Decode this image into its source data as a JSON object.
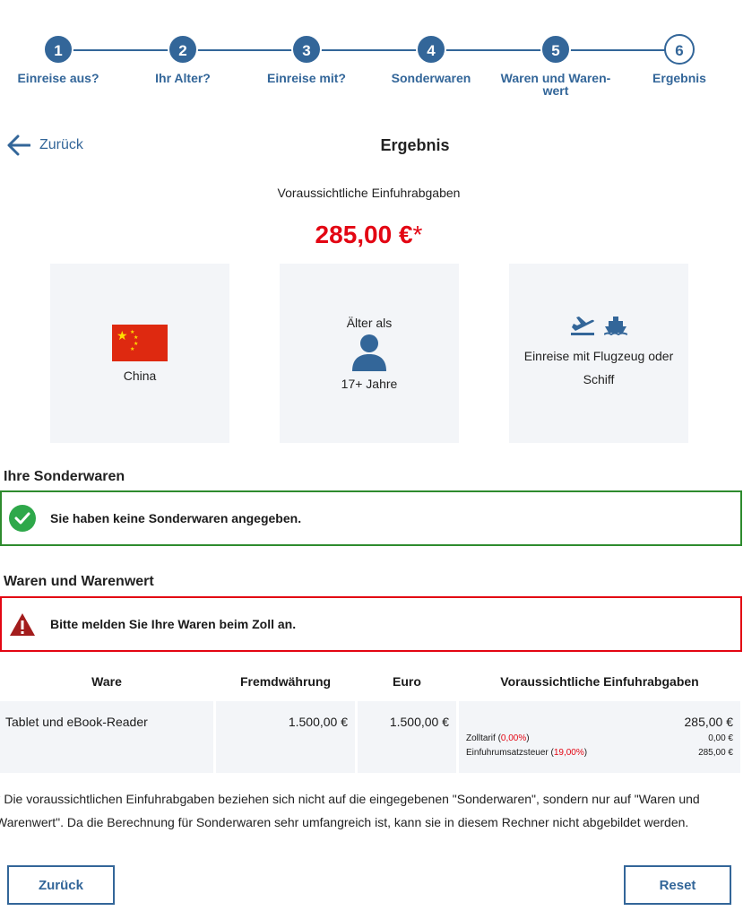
{
  "stepper": {
    "steps": [
      {
        "number": "1",
        "label": "Einreise aus?"
      },
      {
        "number": "2",
        "label": "Ihr Alter?"
      },
      {
        "number": "3",
        "label": "Einreise mit?"
      },
      {
        "number": "4",
        "label": "Sonderwaren"
      },
      {
        "number": "5",
        "label": "Waren und Waren-wert"
      },
      {
        "number": "6",
        "label": "Ergebnis"
      }
    ],
    "current_step": 6,
    "accent": "#336699"
  },
  "header": {
    "back_label": "Zurück",
    "title": "Ergebnis"
  },
  "result": {
    "subtitle": "Voraussichtliche Einfuhrabgaben",
    "total": "285,00 €",
    "total_marker": "*",
    "total_color": "#e30613"
  },
  "cards": {
    "country": "China",
    "age_prefix": "Älter als",
    "age_value": "17+ Jahre",
    "transport": "Einreise mit Flugzeug oder Schiff"
  },
  "special_goods": {
    "heading": "Ihre Sonderwaren",
    "message": "Sie haben keine Sonderwaren angegeben."
  },
  "goods": {
    "heading": "Waren und Warenwert",
    "message": "Bitte melden Sie Ihre Waren beim Zoll an."
  },
  "table": {
    "headers": [
      "Ware",
      "Fremdwährung",
      "Euro",
      "Voraussichtliche Einfuhrabgaben"
    ],
    "rows": [
      {
        "ware": "Tablet und eBook-Reader",
        "foreign": "1.500,00 €",
        "euro": "1.500,00 €",
        "duties": "285,00 €",
        "details": [
          {
            "label": "Zolltarif",
            "rate": "0,00%",
            "amount": "0,00 €"
          },
          {
            "label": "Einfuhrumsatzsteuer",
            "rate": "19,00%",
            "amount": "285,00 €"
          }
        ]
      }
    ]
  },
  "footnote": "* Die voraussichtlichen Einfuhrabgaben beziehen sich nicht auf die eingegebenen \"Sonderwaren\", sondern nur auf \"Waren und Warenwert\". Da die Berechnung für Sonderwaren sehr umfangreich ist, kann sie in diesem Rechner nicht abgebildet werden.",
  "buttons": {
    "back": "Zurück",
    "reset": "Reset"
  }
}
